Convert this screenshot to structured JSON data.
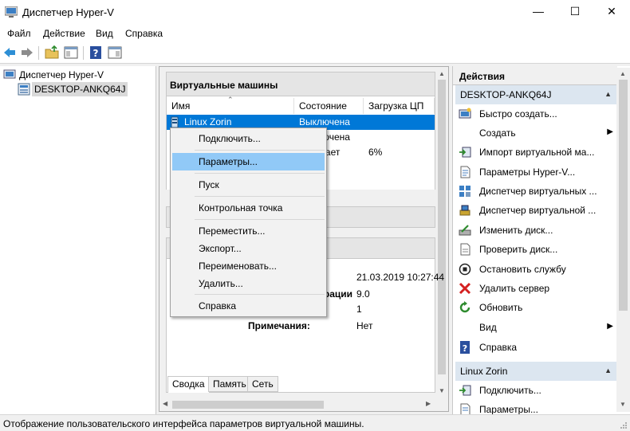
{
  "window": {
    "title": "Диспетчер Hyper-V",
    "minimize": "—",
    "maximize": "☐",
    "close": "✕"
  },
  "menu": {
    "file": "Файл",
    "action": "Действие",
    "view": "Вид",
    "help": "Справка"
  },
  "tree": {
    "root": "Диспетчер Hyper-V",
    "host": "DESKTOP-ANKQ64J"
  },
  "vms": {
    "title": "Виртуальные машины",
    "columns": {
      "name": "Имя",
      "state": "Состояние",
      "cpu": "Загрузка ЦП"
    },
    "rows": [
      {
        "name": "Linux Zorin",
        "state": "Выключена",
        "cpu": ""
      },
      {
        "name": "",
        "state": "Выключена",
        "cpu": ""
      },
      {
        "name": "",
        "state": "Работает",
        "cpu": "6%"
      }
    ]
  },
  "details": {
    "created_value": "21.03.2019 10:27:44",
    "config_label": "Версия конфигурации:",
    "config_value": "9.0",
    "generation_value": "1",
    "notes_label": "Примечания:",
    "notes_value": "Нет",
    "tabs": [
      "Сводка",
      "Память",
      "Сеть"
    ]
  },
  "context_menu": {
    "items": [
      "Подключить...",
      "Параметры...",
      "Пуск",
      "Контрольная точка",
      "Переместить...",
      "Экспорт...",
      "Переименовать...",
      "Удалить...",
      "Справка"
    ],
    "highlighted": "Параметры..."
  },
  "actions": {
    "title": "Действия",
    "host_group": "DESKTOP-ANKQ64J",
    "host_items": [
      "Быстро создать...",
      "Создать",
      "Импорт виртуальной ма...",
      "Параметры Hyper-V...",
      "Диспетчер виртуальных ...",
      "Диспетчер виртуальной ...",
      "Изменить диск...",
      "Проверить диск...",
      "Остановить службу",
      "Удалить сервер",
      "Обновить",
      "Вид",
      "Справка"
    ],
    "vm_group": "Linux Zorin",
    "vm_items": [
      "Подключить...",
      "Параметры..."
    ]
  },
  "status": {
    "text": "Отображение пользовательского интерфейса параметров виртуальной машины."
  },
  "colors": {
    "selection": "#0078d7",
    "menu_highlight": "#91c9f7",
    "group_header": "#dce6f0"
  }
}
